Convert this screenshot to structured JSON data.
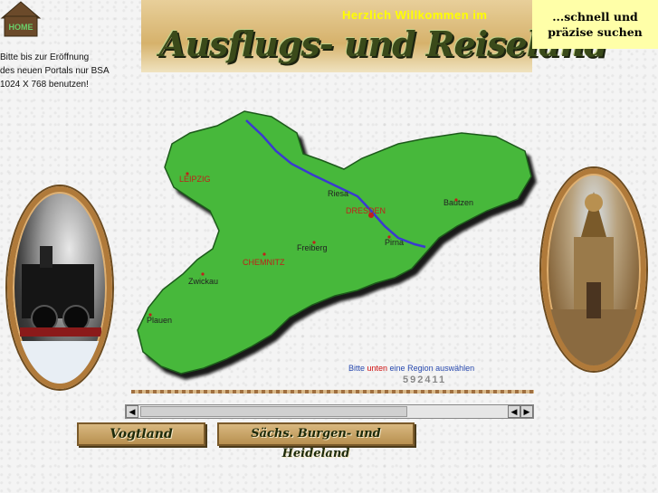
{
  "home": {
    "label": "HOME"
  },
  "notice": {
    "line1": "Bitte bis zur Eröffnung",
    "line2": "des neuen Portals nur BSA",
    "line3": "1024 X 768 benutzen!"
  },
  "header": {
    "welcome": "Herzlich  Willkommen  im",
    "title": "Ausflugs- und Reiseland"
  },
  "search": {
    "line1": "...schnell und",
    "line2": "präzise suchen"
  },
  "map": {
    "cities": {
      "leipzig": "LEIPZIG",
      "riesa": "Riesa",
      "dresden": "DRESDEN",
      "bautzen": "Bautzen",
      "pirna": "Pirna",
      "freiberg": "Freiberg",
      "chemnitz": "CHEMNITZ",
      "zwickau": "Zwickau",
      "plauen": "Plauen"
    }
  },
  "prompt": {
    "pre": "Bitte ",
    "hl": "unten",
    "post": " eine Region auswählen"
  },
  "counter": "592411",
  "nav": {
    "vogtland": "Vogtland",
    "burgen": "Sächs. Burgen- und Heideland"
  },
  "colors": {
    "map_green": "#46b83a",
    "river": "#3a3ad0",
    "search_bg": "#ffffa8"
  }
}
